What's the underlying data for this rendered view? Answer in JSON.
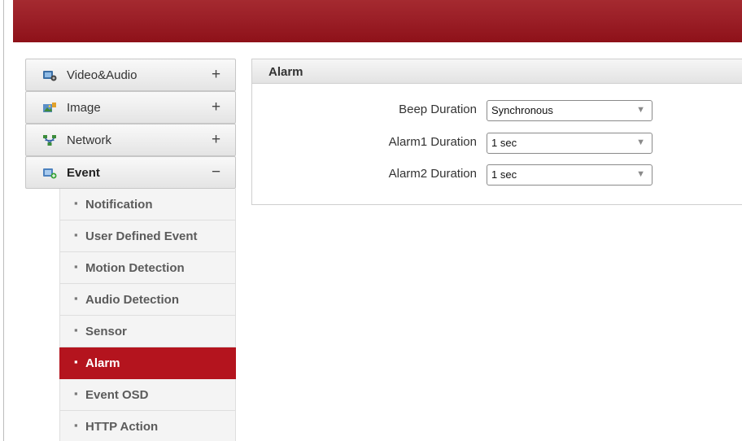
{
  "sidebar": {
    "categories": [
      {
        "label": "Video&Audio",
        "toggle": "+",
        "icon": "video-audio-icon"
      },
      {
        "label": "Image",
        "toggle": "+",
        "icon": "image-icon"
      },
      {
        "label": "Network",
        "toggle": "+",
        "icon": "network-icon"
      },
      {
        "label": "Event",
        "toggle": "−",
        "icon": "event-icon"
      }
    ],
    "event_items": [
      {
        "label": "Notification"
      },
      {
        "label": "User Defined Event"
      },
      {
        "label": "Motion Detection"
      },
      {
        "label": "Audio Detection"
      },
      {
        "label": "Sensor"
      },
      {
        "label": "Alarm",
        "active": true
      },
      {
        "label": "Event OSD"
      },
      {
        "label": "HTTP Action"
      }
    ],
    "bullet": "▪"
  },
  "panel": {
    "title": "Alarm",
    "rows": [
      {
        "label": "Beep Duration",
        "value": "Synchronous"
      },
      {
        "label": "Alarm1 Duration",
        "value": "1 sec"
      },
      {
        "label": "Alarm2 Duration",
        "value": "1 sec"
      }
    ]
  },
  "colors": {
    "brand_red": "#9b1f27",
    "active_red": "#b4141e"
  }
}
